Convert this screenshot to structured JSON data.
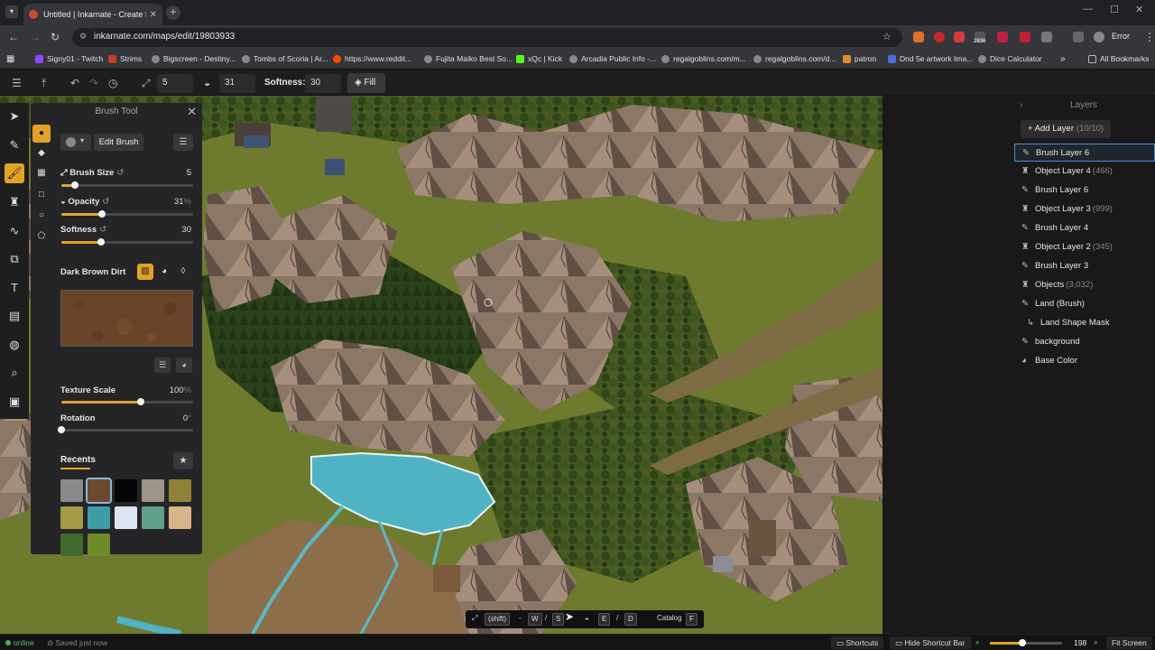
{
  "browser": {
    "tab_title": "Untitled | Inkarnate - Create Fa",
    "url": "inkarnate.com/maps/edit/19803933",
    "profile_label": "Error",
    "bookmarks": [
      "Signy01 - Twitch",
      "Strims",
      "Bigscreen - Destiny...",
      "Tombs of Scoria | Ar...",
      "https://www.reddit...",
      "Fujita Maiko Best So...",
      "xQc | Kick",
      "Arcadia Public Info -...",
      "regalgoblins.com/m...",
      "regalgoblins.com/d...",
      "patron",
      "Dnd 5e artwork Ima...",
      "Dice Calculator"
    ],
    "all_bookmarks": "All Bookmarks",
    "extension_badge": "2836"
  },
  "toolbar": {
    "size_value": "5",
    "opacity_value": "31",
    "softness_label": "Softness:",
    "softness_value": "30",
    "fill_label": "Fill"
  },
  "brush_panel": {
    "title": "Brush Tool",
    "edit_brush": "Edit Brush",
    "brush_size_label": "Brush Size",
    "brush_size_value": "5",
    "brush_size_fraction": 0.1,
    "opacity_label": "Opacity",
    "opacity_value": "31",
    "opacity_unit": "%",
    "opacity_fraction": 0.31,
    "softness_label": "Softness",
    "softness_value": "30",
    "softness_fraction": 0.3,
    "material_name": "Dark Brown Dirt",
    "texture_scale_label": "Texture Scale",
    "texture_scale_value": "100",
    "texture_scale_unit": "%",
    "texture_scale_fraction": 0.6,
    "rotation_label": "Rotation",
    "rotation_value": "0",
    "rotation_unit": "°",
    "rotation_fraction": 0.0,
    "recents_label": "Recents",
    "recent_colors": [
      "#8a8a8a",
      "#6b4a30",
      "#050505",
      "#9c9689",
      "#8e8238",
      "#a39a4a",
      "#3f9ca6",
      "#dbe6f0",
      "#5fa08a",
      "#d9b48a",
      "#3f6b2c",
      "#6f8a2a"
    ]
  },
  "layers": {
    "title": "Layers",
    "add_layer": "Add Layer",
    "add_layer_count": "(10/10)",
    "items": [
      {
        "name": "Brush Layer 6",
        "count": "",
        "icon": "brush-icon",
        "selected": true
      },
      {
        "name": "Object Layer 4",
        "count": "(466)",
        "icon": "object-icon",
        "selected": false
      },
      {
        "name": "Brush Layer 6",
        "count": "",
        "icon": "brush-icon",
        "selected": false
      },
      {
        "name": "Object Layer 3",
        "count": "(999)",
        "icon": "object-icon",
        "selected": false
      },
      {
        "name": "Brush Layer 4",
        "count": "",
        "icon": "brush-icon",
        "selected": false
      },
      {
        "name": "Object Layer 2",
        "count": "(345)",
        "icon": "object-icon",
        "selected": false
      },
      {
        "name": "Brush Layer 3",
        "count": "",
        "icon": "brush-icon",
        "selected": false
      },
      {
        "name": "Objects",
        "count": "(3,032)",
        "icon": "object-icon",
        "selected": false
      },
      {
        "name": "Land (Brush)",
        "count": "",
        "icon": "brush-icon",
        "selected": false
      },
      {
        "name": "Land Shape Mask",
        "count": "",
        "icon": "mask-icon",
        "selected": false
      },
      {
        "name": "background",
        "count": "",
        "icon": "brush-icon",
        "selected": false
      },
      {
        "name": "Base Color",
        "count": "",
        "icon": "palette-icon",
        "selected": false
      }
    ]
  },
  "shortcut_bar": {
    "shift": "(shift)",
    "w": "W",
    "s": "S",
    "e": "E",
    "d": "D",
    "catalog": "Catalog",
    "f": "F",
    "sep1": "-",
    "sep2": "/",
    "sep3": "/"
  },
  "status": {
    "online": "online",
    "saved": "Saved just now",
    "shortcuts": "Shortcuts",
    "hide_shortcut_bar": "Hide Shortcut Bar",
    "zoom_value": "198",
    "fit_screen": "Fit Screen"
  },
  "colors": {
    "accent": "#e2a22a",
    "selection": "#4d8fd0",
    "material": "#6a4428",
    "water": "#4fb3c4"
  }
}
